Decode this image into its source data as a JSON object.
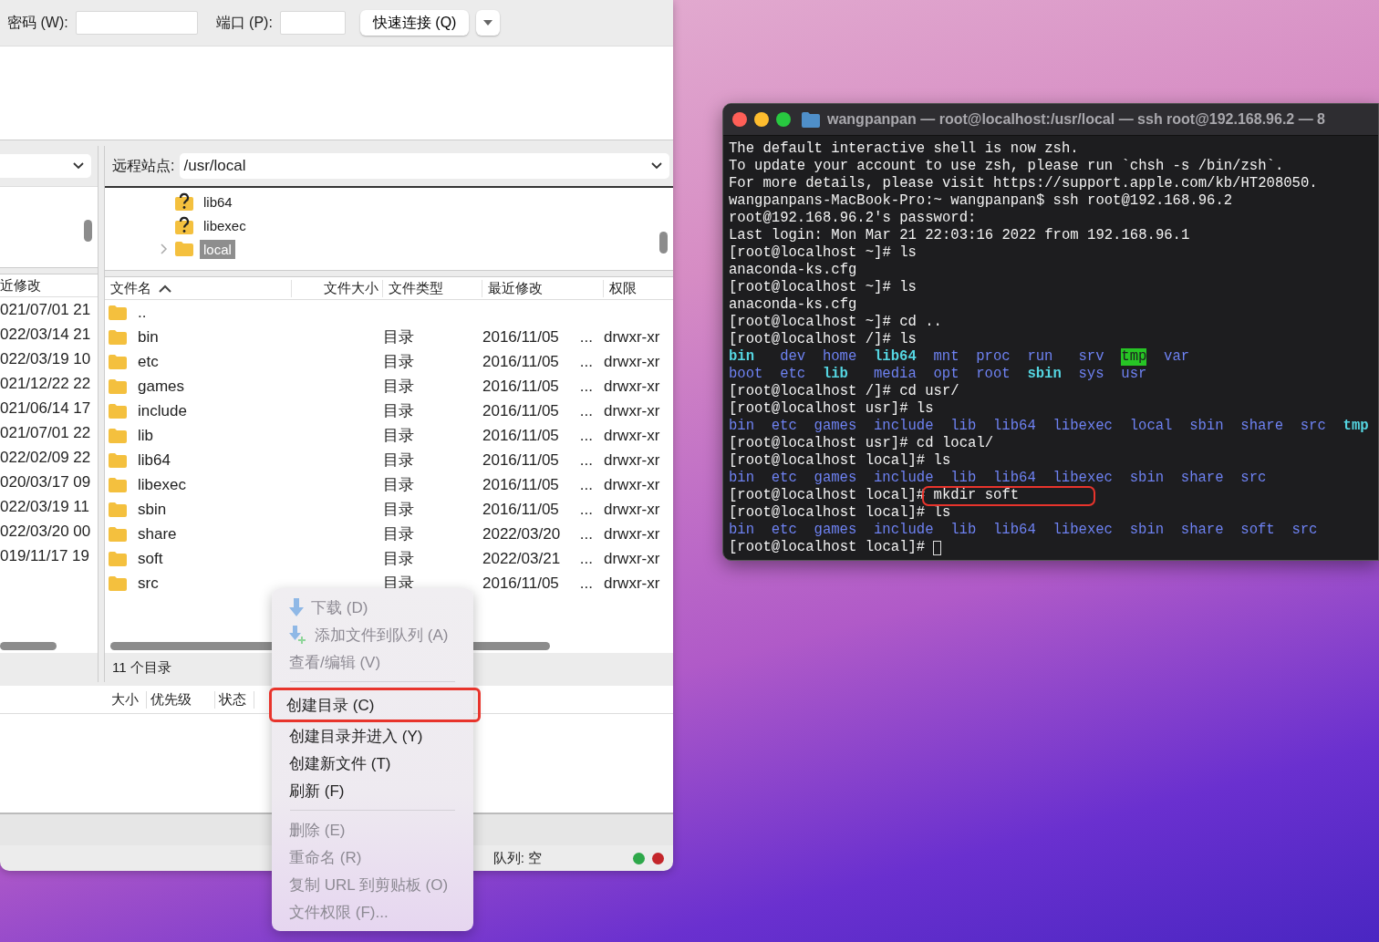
{
  "toolbar": {
    "fields": [
      {
        "label": "密码 (W):",
        "kind": "wide"
      },
      {
        "label": "端口 (P):",
        "kind": "narrow"
      }
    ],
    "connect_button": "快速连接 (Q)"
  },
  "local_panel": {
    "list_header": "近修改",
    "dates": [
      "021/07/01 21",
      "022/03/14 21",
      "022/03/19 10",
      "021/12/22 22",
      "021/06/14 17",
      "021/07/01 22",
      "022/02/09 22",
      "020/03/17 09",
      "022/03/19 11",
      "022/03/20 00",
      "019/11/17 19"
    ]
  },
  "remote_panel": {
    "label": "远程站点:",
    "path": "/usr/local",
    "tree": [
      {
        "name": "lib64",
        "kind": "unknown",
        "selected": false,
        "expandable": false
      },
      {
        "name": "libexec",
        "kind": "unknown",
        "selected": false,
        "expandable": false
      },
      {
        "name": "local",
        "kind": "folder",
        "selected": true,
        "expandable": true
      }
    ],
    "columns": [
      {
        "label": "文件名",
        "sorted": true
      },
      {
        "label": "文件大小",
        "sorted": false
      },
      {
        "label": "文件类型",
        "sorted": false
      },
      {
        "label": "最近修改",
        "sorted": false
      },
      {
        "label": "权限",
        "sorted": false
      }
    ],
    "rows": [
      {
        "name": ".."
      },
      {
        "name": "bin",
        "type": "目录",
        "modified": "2016/11/05",
        "more": "...",
        "permissions": "drwxr-xr"
      },
      {
        "name": "etc",
        "type": "目录",
        "modified": "2016/11/05",
        "more": "...",
        "permissions": "drwxr-xr"
      },
      {
        "name": "games",
        "type": "目录",
        "modified": "2016/11/05",
        "more": "...",
        "permissions": "drwxr-xr"
      },
      {
        "name": "include",
        "type": "目录",
        "modified": "2016/11/05",
        "more": "...",
        "permissions": "drwxr-xr"
      },
      {
        "name": "lib",
        "type": "目录",
        "modified": "2016/11/05",
        "more": "...",
        "permissions": "drwxr-xr"
      },
      {
        "name": "lib64",
        "type": "目录",
        "modified": "2016/11/05",
        "more": "...",
        "permissions": "drwxr-xr"
      },
      {
        "name": "libexec",
        "type": "目录",
        "modified": "2016/11/05",
        "more": "...",
        "permissions": "drwxr-xr"
      },
      {
        "name": "sbin",
        "type": "目录",
        "modified": "2016/11/05",
        "more": "...",
        "permissions": "drwxr-xr"
      },
      {
        "name": "share",
        "type": "目录",
        "modified": "2022/03/20",
        "more": "...",
        "permissions": "drwxr-xr"
      },
      {
        "name": "soft",
        "type": "目录",
        "modified": "2022/03/21",
        "more": "...",
        "permissions": "drwxr-xr"
      },
      {
        "name": "src",
        "type": "目录",
        "modified": "2016/11/05",
        "more": "...",
        "permissions": "drwxr-xr"
      }
    ],
    "status": "11 个目录"
  },
  "queue": {
    "columns": [
      "大小",
      "优先级",
      "状态"
    ]
  },
  "status_bar": {
    "queue": "队列: 空",
    "indicators": [
      {
        "color": "#2ea84a"
      },
      {
        "color": "#c4262b"
      }
    ]
  },
  "context_menu": {
    "items": [
      {
        "kind": "item",
        "label": "下载 (D)",
        "disabled": true,
        "marked": false
      },
      {
        "kind": "item",
        "label": "添加文件到队列 (A)",
        "disabled": true,
        "marked": false
      },
      {
        "kind": "item",
        "label": "查看/编辑 (V)",
        "disabled": true,
        "marked": false
      },
      {
        "kind": "separator"
      },
      {
        "kind": "item",
        "label": "创建目录 (C)",
        "disabled": false,
        "marked": true
      },
      {
        "kind": "item",
        "label": "创建目录并进入 (Y)",
        "disabled": false,
        "marked": false
      },
      {
        "kind": "item",
        "label": "创建新文件 (T)",
        "disabled": false,
        "marked": false
      },
      {
        "kind": "item",
        "label": "刷新 (F)",
        "disabled": false,
        "marked": false
      },
      {
        "kind": "separator"
      },
      {
        "kind": "item",
        "label": "删除 (E)",
        "disabled": true,
        "marked": false
      },
      {
        "kind": "item",
        "label": "重命名 (R)",
        "disabled": true,
        "marked": false
      },
      {
        "kind": "item",
        "label": "复制 URL 到剪贴板 (O)",
        "disabled": true,
        "marked": false
      },
      {
        "kind": "item",
        "label": "文件权限 (F)...",
        "disabled": true,
        "marked": false
      }
    ]
  },
  "terminal": {
    "title": "wangpanpan — root@localhost:/usr/local — ssh root@192.168.96.2 — 8",
    "annotation_frame": true,
    "lines": [
      {
        "kind": "text",
        "text": "The default interactive shell is now zsh."
      },
      {
        "kind": "text",
        "text": "To update your account to use zsh, please run `chsh -s /bin/zsh`."
      },
      {
        "kind": "text",
        "text": "For more details, please visit https://support.apple.com/kb/HT208050."
      },
      {
        "kind": "text",
        "text": "wangpanpans-MacBook-Pro:~ wangpanpan$ ssh root@192.168.96.2"
      },
      {
        "kind": "text",
        "text": "root@192.168.96.2's password:"
      },
      {
        "kind": "text",
        "text": "Last login: Mon Mar 21 22:03:16 2022 from 192.168.96.1"
      },
      {
        "kind": "text",
        "text": "[root@localhost ~]# ls"
      },
      {
        "kind": "text",
        "text": "anaconda-ks.cfg"
      },
      {
        "kind": "text",
        "text": "[root@localhost ~]# ls"
      },
      {
        "kind": "text",
        "text": "anaconda-ks.cfg"
      },
      {
        "kind": "text",
        "text": "[root@localhost ~]# cd .."
      },
      {
        "kind": "text",
        "text": "[root@localhost /]# ls"
      },
      {
        "kind": "ls",
        "rows": [
          [
            {
              "text": "bin",
              "kind": "link"
            },
            {
              "text": "dev",
              "kind": "dir"
            },
            {
              "text": "home",
              "kind": "dir"
            },
            {
              "text": "lib64",
              "kind": "link"
            },
            {
              "text": "mnt",
              "kind": "dir"
            },
            {
              "text": "proc",
              "kind": "dir"
            },
            {
              "text": "run",
              "kind": "dir"
            },
            {
              "text": "srv",
              "kind": "dir"
            },
            {
              "text": "tmp",
              "kind": "sticky"
            },
            {
              "text": "var",
              "kind": "dir"
            }
          ],
          [
            {
              "text": "boot",
              "kind": "dir"
            },
            {
              "text": "etc",
              "kind": "dir"
            },
            {
              "text": "lib",
              "kind": "link"
            },
            {
              "text": "media",
              "kind": "dir"
            },
            {
              "text": "opt",
              "kind": "dir"
            },
            {
              "text": "root",
              "kind": "dir"
            },
            {
              "text": "sbin",
              "kind": "link"
            },
            {
              "text": "sys",
              "kind": "dir"
            },
            {
              "text": "usr",
              "kind": "dir"
            }
          ]
        ]
      },
      {
        "kind": "text",
        "text": "[root@localhost /]# cd usr/"
      },
      {
        "kind": "text",
        "text": "[root@localhost usr]# ls"
      },
      {
        "kind": "ls",
        "rows": [
          [
            {
              "text": "bin",
              "kind": "dir"
            },
            {
              "text": "etc",
              "kind": "dir"
            },
            {
              "text": "games",
              "kind": "dir"
            },
            {
              "text": "include",
              "kind": "dir"
            },
            {
              "text": "lib",
              "kind": "dir"
            },
            {
              "text": "lib64",
              "kind": "dir"
            },
            {
              "text": "libexec",
              "kind": "dir"
            },
            {
              "text": "local",
              "kind": "dir"
            },
            {
              "text": "sbin",
              "kind": "dir"
            },
            {
              "text": "share",
              "kind": "dir"
            },
            {
              "text": "src",
              "kind": "dir"
            },
            {
              "text": "tmp",
              "kind": "link"
            }
          ]
        ]
      },
      {
        "kind": "text",
        "text": "[root@localhost usr]# cd local/"
      },
      {
        "kind": "text",
        "text": "[root@localhost local]# ls"
      },
      {
        "kind": "ls",
        "rows": [
          [
            {
              "text": "bin",
              "kind": "dir"
            },
            {
              "text": "etc",
              "kind": "dir"
            },
            {
              "text": "games",
              "kind": "dir"
            },
            {
              "text": "include",
              "kind": "dir"
            },
            {
              "text": "lib",
              "kind": "dir"
            },
            {
              "text": "lib64",
              "kind": "dir"
            },
            {
              "text": "libexec",
              "kind": "dir"
            },
            {
              "text": "sbin",
              "kind": "dir"
            },
            {
              "text": "share",
              "kind": "dir"
            },
            {
              "text": "src",
              "kind": "dir"
            }
          ]
        ]
      },
      {
        "kind": "text",
        "text": "[root@localhost local]# mkdir soft"
      },
      {
        "kind": "text",
        "text": "[root@localhost local]# ls"
      },
      {
        "kind": "ls",
        "rows": [
          [
            {
              "text": "bin",
              "kind": "dir"
            },
            {
              "text": "etc",
              "kind": "dir"
            },
            {
              "text": "games",
              "kind": "dir"
            },
            {
              "text": "include",
              "kind": "dir"
            },
            {
              "text": "lib",
              "kind": "dir"
            },
            {
              "text": "lib64",
              "kind": "dir"
            },
            {
              "text": "libexec",
              "kind": "dir"
            },
            {
              "text": "sbin",
              "kind": "dir"
            },
            {
              "text": "share",
              "kind": "dir"
            },
            {
              "text": "soft",
              "kind": "dir"
            },
            {
              "text": "src",
              "kind": "dir"
            }
          ]
        ]
      },
      {
        "kind": "prompt",
        "text": "[root@localhost local]#",
        "cursor": true
      }
    ]
  }
}
